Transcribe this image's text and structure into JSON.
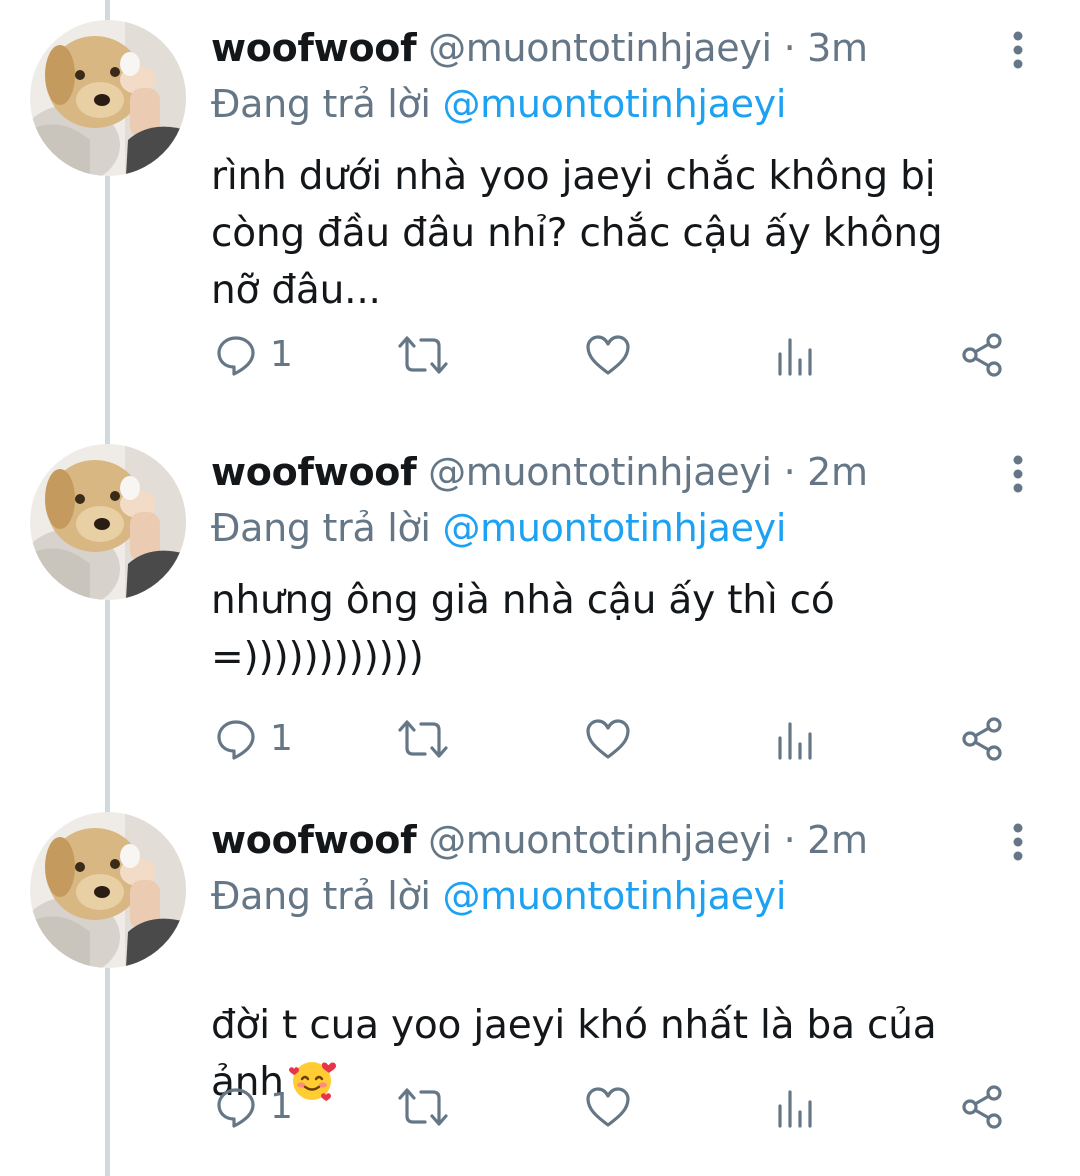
{
  "thread": {
    "tweets": [
      {
        "display_name": "woofwoof",
        "handle": "@muontotinhjaeyi",
        "separator": "·",
        "time": "3m",
        "reply_prefix": "Đang trả lời",
        "reply_to": "@muontotinhjaeyi",
        "text": "rình dưới nhà yoo jaeyi chắc không bị\ncòng đầu đâu nhỉ? chắc cậu ấy không\nnỡ đâu...",
        "emoji": "",
        "reply_count": "1"
      },
      {
        "display_name": "woofwoof",
        "handle": "@muontotinhjaeyi",
        "separator": "·",
        "time": "2m",
        "reply_prefix": "Đang trả lời",
        "reply_to": "@muontotinhjaeyi",
        "text": "nhưng ông già nhà cậu ấy thì có\n=))))))))))))",
        "emoji": "",
        "reply_count": "1"
      },
      {
        "display_name": "woofwoof",
        "handle": "@muontotinhjaeyi",
        "separator": "·",
        "time": "2m",
        "reply_prefix": "Đang trả lời",
        "reply_to": "@muontotinhjaeyi",
        "text": "đời t cua yoo jaeyi khó nhất là ba của\nảnh",
        "emoji": "smiling-face-with-hearts",
        "reply_count": "1"
      }
    ]
  },
  "icons": {
    "reply": "speech-bubble-icon",
    "retweet": "retweet-icon",
    "like": "heart-icon",
    "analytics": "bar-chart-icon",
    "share": "share-icon",
    "more": "vertical-dots-icon"
  },
  "colors": {
    "name": "#14171a",
    "secondary": "#657786",
    "mention": "#1da1f2",
    "thread_line": "#cfd9de"
  }
}
